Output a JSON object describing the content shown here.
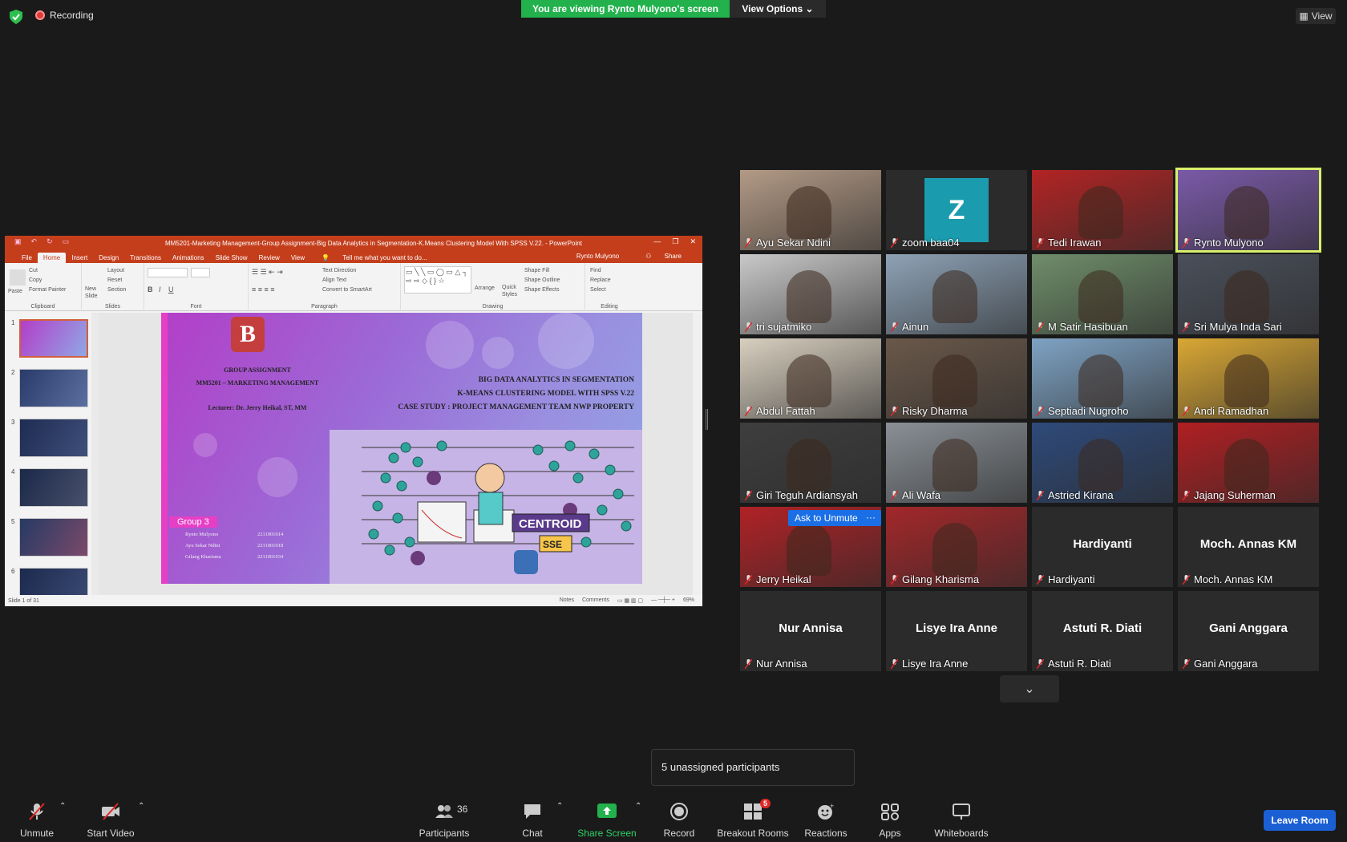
{
  "top": {
    "recording_label": "Recording",
    "viewing_banner": "You are viewing Rynto Mulyono's screen",
    "view_options_label": "View Options",
    "view_button_label": "View"
  },
  "ppt": {
    "window_title": "MM5201-Marketing Management-Group Assignment-Big Data Analytics in Segmentation-K.Means Clustering Model With SPSS V.22. - PowerPoint",
    "tabs": [
      "File",
      "Home",
      "Insert",
      "Design",
      "Transitions",
      "Animations",
      "Slide Show",
      "Review",
      "View"
    ],
    "tell_me": "Tell me what you want to do...",
    "user": "Rynto Mulyono",
    "share": "Share",
    "ribbon": {
      "clipboard": {
        "paste": "Paste",
        "cut": "Cut",
        "copy": "Copy",
        "format_painter": "Format Painter",
        "label": "Clipboard"
      },
      "slides": {
        "new_slide": "New Slide",
        "layout": "Layout",
        "reset": "Reset",
        "section": "Section",
        "label": "Slides"
      },
      "font": {
        "label": "Font"
      },
      "paragraph": {
        "text_direction": "Text Direction",
        "align_text": "Align Text",
        "convert": "Convert to SmartArt",
        "label": "Paragraph"
      },
      "drawing": {
        "arrange": "Arrange",
        "quick_styles": "Quick Styles",
        "shape_fill": "Shape Fill",
        "shape_outline": "Shape Outline",
        "shape_effects": "Shape Effects",
        "label": "Drawing"
      },
      "editing": {
        "find": "Find",
        "replace": "Replace",
        "select": "Select",
        "label": "Editing"
      }
    },
    "thumb_numbers": [
      "1",
      "2",
      "3",
      "4",
      "5",
      "6"
    ],
    "slide": {
      "logo": "B",
      "group_assignment": "GROUP ASSIGNMENT",
      "course": "MM5201 – MARKETING MANAGEMENT",
      "lecturer": "Lecturer:  Dr. Jerry Heikal, ST, MM",
      "title1": "BIG DATA ANALYTICS IN SEGMENTATION",
      "title2": "K-MEANS CLUSTERING MODEL WITH SPSS V.22",
      "title3": "CASE STUDY : PROJECT MANAGEMENT TEAM NWP PROPERTY",
      "group": "Group 3",
      "members": [
        "Rynto Mulyono",
        "Ayu Sekar Ndini",
        "Gilang Kharisma"
      ],
      "ids": [
        "2211001014",
        "2211001018",
        "2211001034"
      ],
      "centroid": "CENTROID",
      "sse": "SSE"
    },
    "status": {
      "slide_of": "Slide 1 of 31",
      "notes": "Notes",
      "comments": "Comments",
      "zoom": "69%"
    }
  },
  "participants": [
    {
      "name": "Ayu Sekar Ndini",
      "type": "video",
      "bg": "#b39a86"
    },
    {
      "name": "zoom baa04",
      "type": "avatar",
      "initial": "Z"
    },
    {
      "name": "Tedi Irawan",
      "type": "video",
      "bg": "#b22424"
    },
    {
      "name": "Rynto Mulyono",
      "type": "video",
      "bg": "#7a5aa8",
      "active": true
    },
    {
      "name": "tri sujatmiko",
      "type": "video",
      "bg": "#c9c9c9"
    },
    {
      "name": "Ainun",
      "type": "video",
      "bg": "#8ea2b6"
    },
    {
      "name": "M Satir Hasibuan",
      "type": "video",
      "bg": "#6f8d6a"
    },
    {
      "name": "Sri Mulya Inda Sari",
      "type": "video",
      "bg": "#4a4f5a"
    },
    {
      "name": "Abdul Fattah",
      "type": "video",
      "bg": "#d8cfbf"
    },
    {
      "name": "Risky Dharma",
      "type": "video",
      "bg": "#6a584a"
    },
    {
      "name": "Septiadi Nugroho",
      "type": "video",
      "bg": "#7fa3c4"
    },
    {
      "name": "Andi Ramadhan",
      "type": "video",
      "bg": "#d9a734"
    },
    {
      "name": "Giri Teguh Ardiansyah",
      "type": "video",
      "bg": "#3e3e3e"
    },
    {
      "name": "Ali Wafa",
      "type": "video",
      "bg": "#8a9096"
    },
    {
      "name": "Astried Kirana",
      "type": "video",
      "bg": "#2e4a7a"
    },
    {
      "name": "Jajang Suherman",
      "type": "video",
      "bg": "#b01f22"
    },
    {
      "name": "Jerry Heikal",
      "type": "video",
      "bg": "#b02226",
      "ask": true
    },
    {
      "name": "Gilang Kharisma",
      "type": "video",
      "bg": "#a3272a"
    },
    {
      "name": "Hardiyanti",
      "type": "name"
    },
    {
      "name": "Moch. Annas KM",
      "type": "name"
    },
    {
      "name": "Nur Annisa",
      "type": "name"
    },
    {
      "name": "Lisye Ira Anne",
      "type": "name"
    },
    {
      "name": "Astuti R. Diati",
      "type": "name"
    },
    {
      "name": "Gani Anggara",
      "type": "name"
    }
  ],
  "ask_to_unmute": "Ask to Unmute",
  "ask_more": "···",
  "unassigned": "5 unassigned participants",
  "toolbar": {
    "unmute": "Unmute",
    "start_video": "Start Video",
    "participants": "Participants",
    "participants_count": "36",
    "chat": "Chat",
    "share_screen": "Share Screen",
    "record": "Record",
    "breakout": "Breakout Rooms",
    "breakout_badge": "5",
    "reactions": "Reactions",
    "apps": "Apps",
    "whiteboards": "Whiteboards",
    "leave": "Leave Room"
  },
  "colors": {
    "accent_green": "#22b14c",
    "ppt_red": "#c43e1c",
    "leave_blue": "#1b5fd4",
    "active_outline": "#d8f06a"
  }
}
